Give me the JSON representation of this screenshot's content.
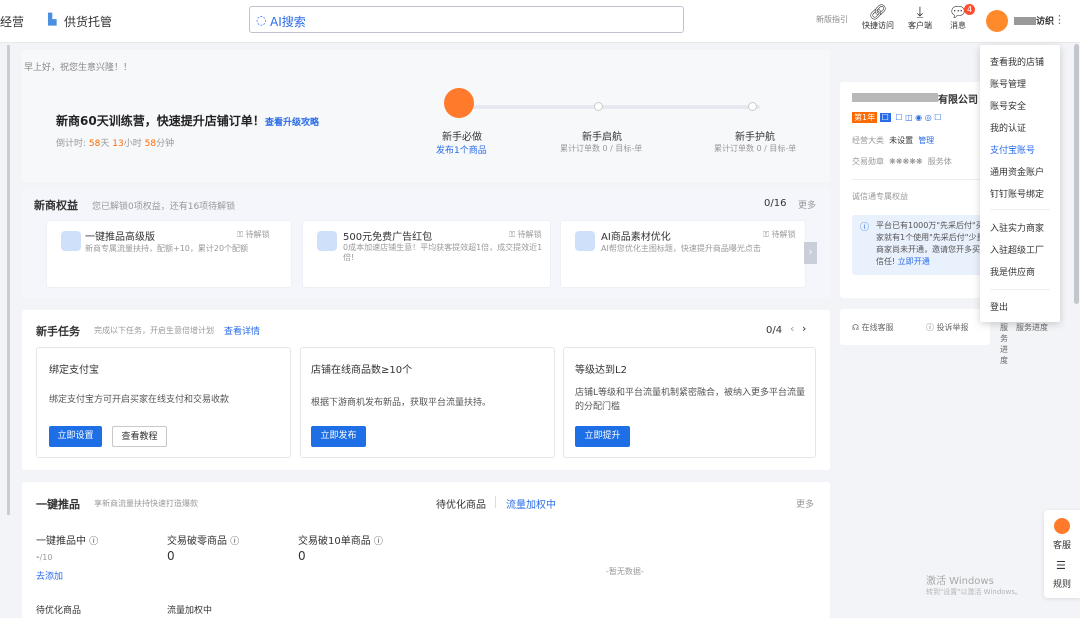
{
  "topbar": {
    "tab_manage": "经营",
    "tab_supply": "供货托管",
    "search_label": "AI搜索",
    "new_guide": "新版指引",
    "quick_access": "快捷访问",
    "client": "客户端",
    "messages": "消息",
    "msg_badge": "4",
    "user_suffix": "访织"
  },
  "greeting": "早上好，祝您生意兴隆！！",
  "camp": {
    "title": "新商60天训练营，快速提升店铺订单！",
    "link": "查看升级攻略",
    "countdown_prefix": "倒计时:",
    "days": "58",
    "days_unit": "天",
    "hours": "13",
    "hours_unit": "小时",
    "mins": "58",
    "mins_unit": "分钟",
    "steps": [
      {
        "title": "新手必做",
        "sub": "发布1个商品"
      },
      {
        "title": "新手启航",
        "sub": "累计订单数 0 / 目标-单"
      },
      {
        "title": "新手护航",
        "sub": "累计订单数 0 / 目标-单"
      }
    ]
  },
  "rights": {
    "title": "新商权益",
    "subtitle": "您已解锁0项权益，还有16项待解锁",
    "count": "0/16",
    "more": "更多",
    "items": [
      {
        "title": "一键推品高级版",
        "status": "待解锁",
        "desc": "新商专属流量扶持，配额+10，累计20个配额"
      },
      {
        "title": "500元免费广告红包",
        "status": "待解锁",
        "desc": "0成本加速店铺生意！平均获客提效超1倍，成交提效近1倍!"
      },
      {
        "title": "AI商品素材优化",
        "status": "待解锁",
        "desc": "AI帮您优化主图标题，快速提升商品曝光点击"
      }
    ]
  },
  "tasks": {
    "title": "新手任务",
    "subtitle": "完成以下任务，开启生意倍增计划",
    "link": "查看详情",
    "count": "0/4",
    "items": [
      {
        "title": "绑定支付宝",
        "desc": "绑定支付宝方可开启买家在线支付和交易收款",
        "btn": "立即设置",
        "btn2": "查看教程"
      },
      {
        "title": "店铺在线商品数≥10个",
        "desc": "根据下游商机发布新品，获取平台流量扶持。",
        "btn": "立即发布"
      },
      {
        "title": "等级达到L2",
        "desc": "店铺L等级和平台流量机制紧密融合，被纳入更多平台流量的分配门槛",
        "btn": "立即提升"
      }
    ]
  },
  "promote": {
    "title": "一键推品",
    "subtitle": "享新商流量扶持快速打造爆款",
    "tab1": "待优化商品",
    "tab2": "流量加权中",
    "more": "更多",
    "stat1_label": "一键推品中",
    "stat1_value": "-",
    "stat1_unit": "/10",
    "add_link": "去添加",
    "stat2_label": "交易破零商品",
    "stat2_value": "0",
    "stat3_label": "交易破10单商品",
    "stat3_value": "0",
    "empty": "-暂无数据-",
    "foot1": "待优化商品",
    "foot2": "流量加权中"
  },
  "company": {
    "name_suffix": "有限公司",
    "badge": "第1年",
    "category_label": "经营大类",
    "category_value": "未设置",
    "manage": "管理",
    "credit_label": "交易勋章",
    "service_label": "服务体",
    "integrity": "诚信通专属权益",
    "notice": "平台已有1000万\"先采后付\"买家就有1个使用\"先采后付\"少量商家尚未开通，邀请您开多买家信任!",
    "notice_link": "立即开通",
    "online_service": "在线客服",
    "complaint": "投诉举报",
    "progress": "服务进度"
  },
  "menu": {
    "items": [
      "查看我的店铺",
      "账号管理",
      "账号安全",
      "我的认证",
      "支付宝账号",
      "通用资金账户",
      "钉钉账号绑定",
      "入驻实力商家",
      "入驻超级工厂",
      "我是供应商",
      "登出"
    ]
  },
  "side": {
    "service": "客服",
    "rules": "规则"
  },
  "watermark": {
    "line1": "激活 Windows",
    "line2": "转到\"设置\"以激活 Windows。"
  },
  "colors": {
    "accent": "#2a6ce8",
    "highlight": "#ff6a00"
  }
}
